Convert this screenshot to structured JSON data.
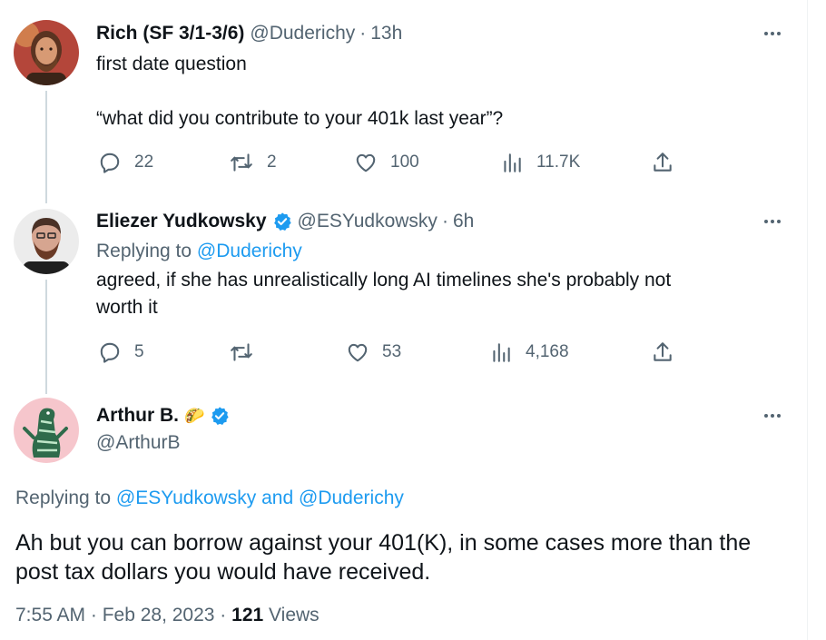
{
  "tweets": [
    {
      "name": "Rich (SF 3/1-3/6)",
      "handle": "@Duderichy",
      "time": "13h",
      "text_line1": "first date question",
      "text_line2": "“what did you contribute to your 401k last year”?",
      "replies": "22",
      "retweets": "2",
      "likes": "100",
      "views": "11.7K"
    },
    {
      "name": "Eliezer Yudkowsky",
      "handle": "@ESYudkowsky",
      "time": "6h",
      "replying_prefix": "Replying to ",
      "replying_to": "@Duderichy",
      "text_line1": "agreed, if she has unrealistically long AI timelines she's probably not",
      "text_line2": "worth it",
      "replies": "5",
      "retweets": "",
      "likes": "53",
      "views": "4,168"
    }
  ],
  "main_tweet": {
    "name": "Arthur B.",
    "emoji": "🌮",
    "handle": "@ArthurB",
    "replying_prefix": "Replying to ",
    "replying_to_1": "@ESYudkowsky",
    "replying_and": " and ",
    "replying_to_2": "@Duderichy",
    "text_line1": "Ah but you can borrow against your 401(K), in some cases more than the",
    "text_line2": "post tax dollars you would have received.",
    "timestamp": "7:55 AM · Feb 28, 2023 · ",
    "views_count": "121",
    "views_label": " Views"
  },
  "colors": {
    "accent": "#1d9bf0",
    "secondary_text": "#536471",
    "primary_text": "#0f1419",
    "thread_line": "#cfd9de"
  },
  "icons": [
    "reply-icon",
    "retweet-icon",
    "like-icon",
    "views-icon",
    "share-icon",
    "more-icon",
    "verified-badge-icon",
    "taco-emoji"
  ]
}
